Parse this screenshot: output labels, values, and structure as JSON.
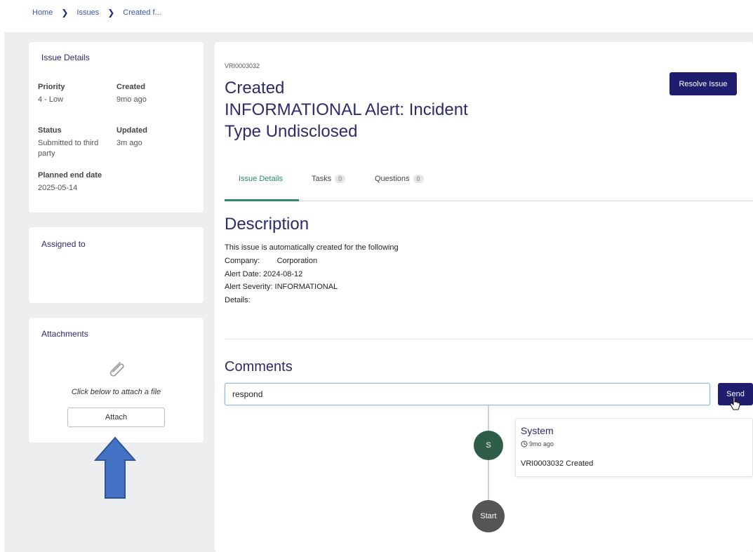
{
  "breadcrumb": {
    "home": "Home",
    "issues": "Issues",
    "current": "Created f..."
  },
  "details": {
    "title": "Issue Details",
    "priority_label": "Priority",
    "priority_value": "4 - Low",
    "created_label": "Created",
    "created_value": "9mo ago",
    "status_label": "Status",
    "status_value": "Submitted to third party",
    "updated_label": "Updated",
    "updated_value": "3m ago",
    "end_label": "Planned end date",
    "end_value": "2025-05-14"
  },
  "assigned": {
    "title": "Assigned to"
  },
  "attachments": {
    "title": "Attachments",
    "hint": "Click below to attach a file",
    "button": "Attach",
    "arrow_color": "#4472c4"
  },
  "issue": {
    "id": "VRI0003032",
    "title_lines": [
      "Created",
      "INFORMATIONAL Alert: Incident",
      "Type Undisclosed"
    ],
    "resolve_label": "Resolve Issue"
  },
  "tabs": [
    {
      "label": "Issue Details",
      "badge": ""
    },
    {
      "label": "Tasks",
      "badge": "0"
    },
    {
      "label": "Questions",
      "badge": "0"
    }
  ],
  "description": {
    "title": "Description",
    "lines": [
      "This issue is automatically created for the following",
      "Company:        Corporation",
      "Alert Date: 2024-08-12",
      "Alert Severity: INFORMATIONAL",
      "Details:"
    ]
  },
  "comments": {
    "title": "Comments",
    "input_value": "respond",
    "send_label": "Send",
    "entries": [
      {
        "avatar": "S",
        "author": "System",
        "time": "9mo ago",
        "text": "VRI0003032 Created"
      }
    ],
    "start_label": "Start"
  },
  "colors": {
    "primary": "#1f1d6e",
    "accent": "#2e8b62",
    "heading": "#2d2a6e"
  }
}
